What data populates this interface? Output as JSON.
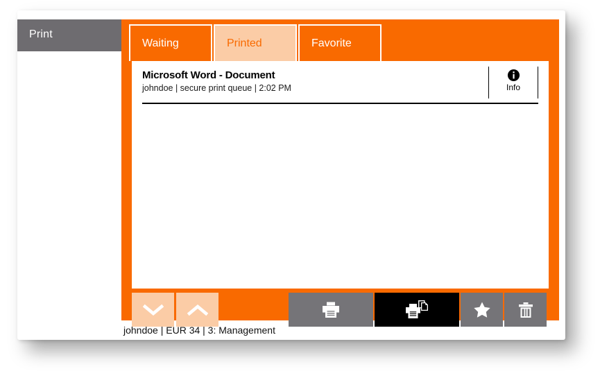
{
  "app": {
    "header_label": "Print",
    "accent_color": "#f96a00",
    "accent_light_color": "#fbcca6",
    "gray_color": "#757478",
    "header_gray_color": "#6e6c70",
    "black_color": "#000000"
  },
  "tabs": [
    {
      "label": "Waiting",
      "state": "orange"
    },
    {
      "label": "Printed",
      "state": "peach"
    },
    {
      "label": "Favorite",
      "state": "orange"
    }
  ],
  "job_list": {
    "rows": [
      {
        "title": "Microsoft Word - Document",
        "details": "johndoe | secure print queue | 2:02 PM",
        "info_label": "Info",
        "info_icon": "info-circle-icon"
      }
    ]
  },
  "toolbar": {
    "scroll_down": {
      "icon": "chevron-down-icon",
      "style": "peach"
    },
    "scroll_up": {
      "icon": "chevron-up-icon",
      "style": "peach"
    },
    "actions": [
      {
        "name": "print",
        "icon": "printer-icon",
        "style": "gray"
      },
      {
        "name": "print-and-keep",
        "icon": "printer-copy-icon",
        "style": "black"
      },
      {
        "name": "favorite",
        "icon": "star-icon",
        "style": "gray"
      },
      {
        "name": "delete",
        "icon": "trash-icon",
        "style": "gray"
      }
    ]
  },
  "status_bar": {
    "text": "johndoe | EUR 34 | 3: Management"
  }
}
